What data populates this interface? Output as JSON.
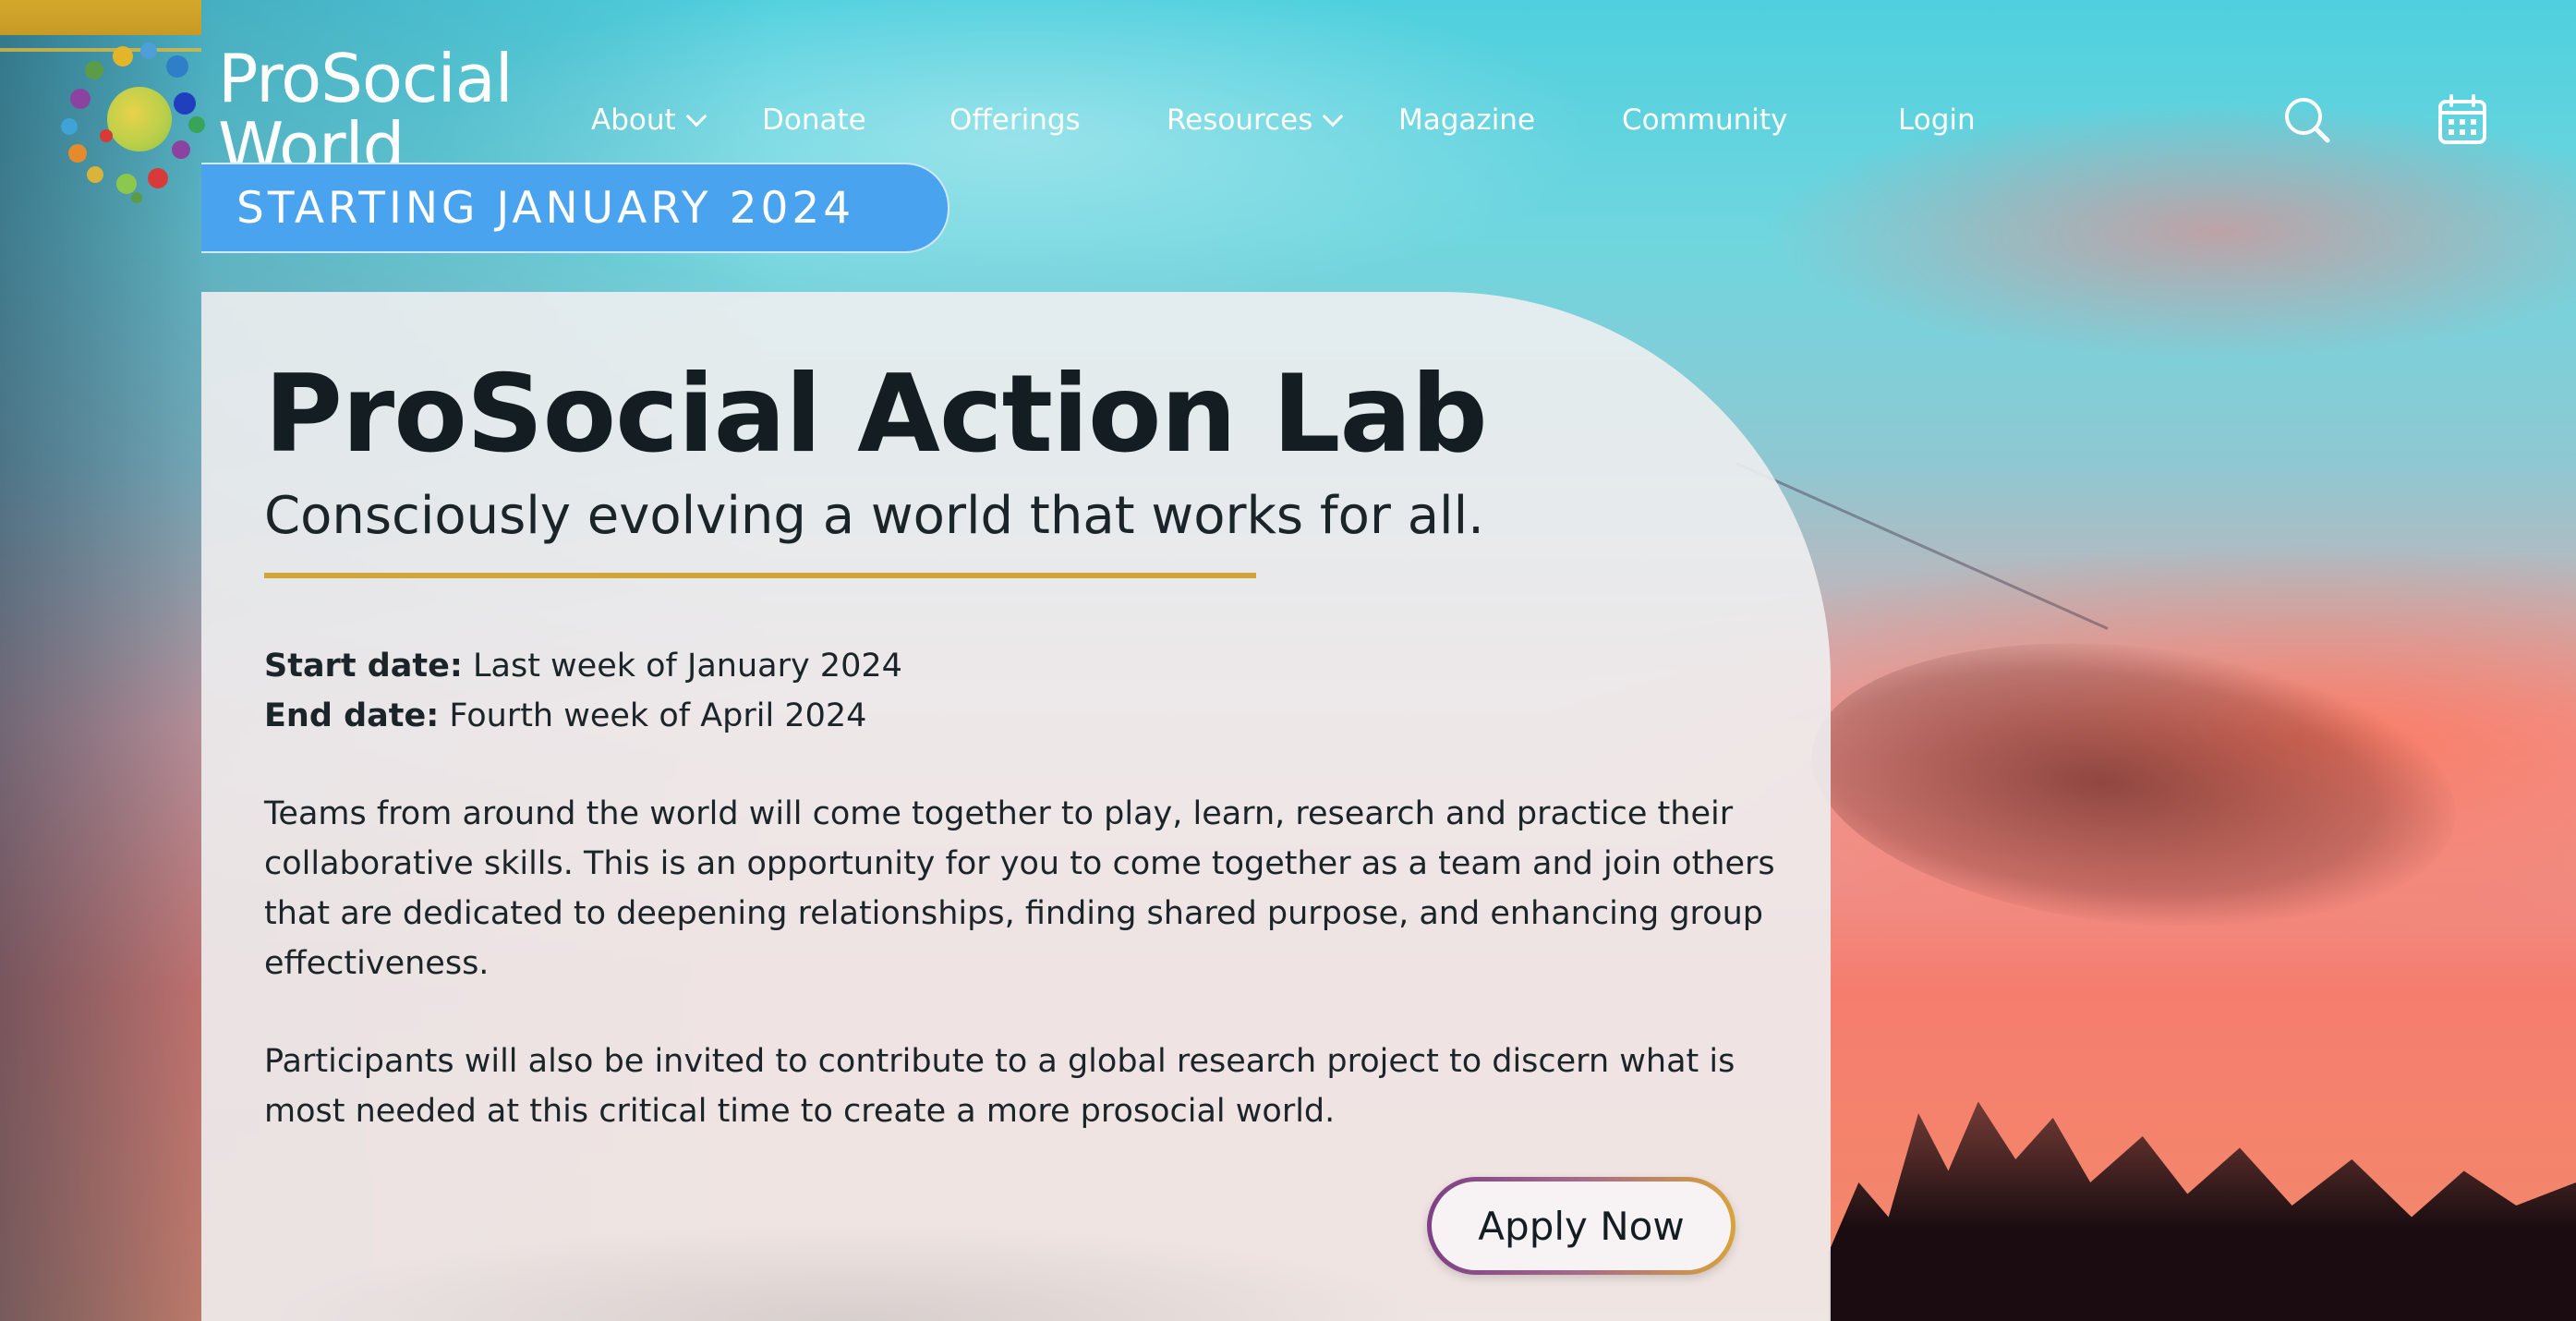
{
  "header": {
    "logo_line1": "ProSocial",
    "logo_line2": "World",
    "nav": [
      {
        "label": "About",
        "has_dropdown": true
      },
      {
        "label": "Donate",
        "has_dropdown": false
      },
      {
        "label": "Offerings",
        "has_dropdown": false
      },
      {
        "label": "Resources",
        "has_dropdown": true
      },
      {
        "label": "Magazine",
        "has_dropdown": false
      },
      {
        "label": "Community",
        "has_dropdown": false
      },
      {
        "label": "Login",
        "has_dropdown": false
      }
    ],
    "icons": {
      "search": "search-icon",
      "calendar": "calendar-icon"
    }
  },
  "hero": {
    "badge": "STARTING JANUARY 2024",
    "title": "ProSocial Action Lab",
    "subtitle": "Consciously evolving a world that works for all.",
    "start_label": "Start date:",
    "start_value": "Last week of January 2024",
    "end_label": "End date:",
    "end_value": "Fourth week of April 2024",
    "paragraph1": "Teams from around the world will come together to play, learn, research and practice their collaborative skills. This is an opportunity for you to come together as a team and join others that are dedicated to deepening relationships, finding shared purpose, and enhancing group effectiveness.",
    "paragraph2": "Participants will also be invited to contribute to a global research project to discern what is most needed at this critical time to create a more prosocial world.",
    "cta": "Apply Now"
  },
  "colors": {
    "badge_blue": "#4aa3ee",
    "accent_gold": "#d1a53a",
    "text_dark": "#141e22",
    "button_gradient_start": "#7d3f86",
    "button_gradient_end": "#d9a33a"
  }
}
